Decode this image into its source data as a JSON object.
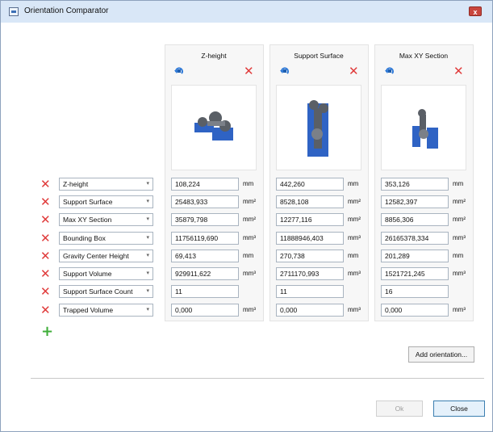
{
  "window": {
    "title": "Orientation Comparator",
    "close_glyph": "x"
  },
  "columns": [
    {
      "title": "Z-height",
      "rotate_icon": "rotate-icon",
      "remove_icon": "remove-icon",
      "values": [
        "108,224",
        "25483,933",
        "35879,798",
        "11756119,690",
        "69,413",
        "929911,622",
        "11",
        "0,000"
      ]
    },
    {
      "title": "Support Surface",
      "rotate_icon": "rotate-icon",
      "remove_icon": "remove-icon",
      "values": [
        "442,260",
        "8528,108",
        "12277,116",
        "11888946,403",
        "270,738",
        "2711170,993",
        "11",
        "0,000"
      ]
    },
    {
      "title": "Max XY Section",
      "rotate_icon": "rotate-icon",
      "remove_icon": "remove-icon",
      "values": [
        "353,126",
        "12582,397",
        "8856,306",
        "26165378,334",
        "201,289",
        "1521721,245",
        "16",
        "0,000"
      ]
    }
  ],
  "metrics": [
    {
      "label": "Z-height",
      "unit": "mm"
    },
    {
      "label": "Support Surface",
      "unit": "mm²"
    },
    {
      "label": "Max XY Section",
      "unit": "mm²"
    },
    {
      "label": "Bounding Box",
      "unit": "mm³"
    },
    {
      "label": "Gravity Center Height",
      "unit": "mm"
    },
    {
      "label": "Support Volume",
      "unit": "mm³"
    },
    {
      "label": "Support Surface Count",
      "unit": ""
    },
    {
      "label": "Trapped Volume",
      "unit": "mm³"
    }
  ],
  "glyphs": {
    "remove": "✕",
    "add": "+",
    "dropdown": "▾"
  },
  "buttons": {
    "add_orientation": "Add orientation...",
    "ok": "Ok",
    "close": "Close"
  },
  "colors": {
    "remove_red": "#e03b3b",
    "add_green": "#3fae3a",
    "model_blue": "#2f63c4",
    "model_gray": "#5a5f66"
  }
}
